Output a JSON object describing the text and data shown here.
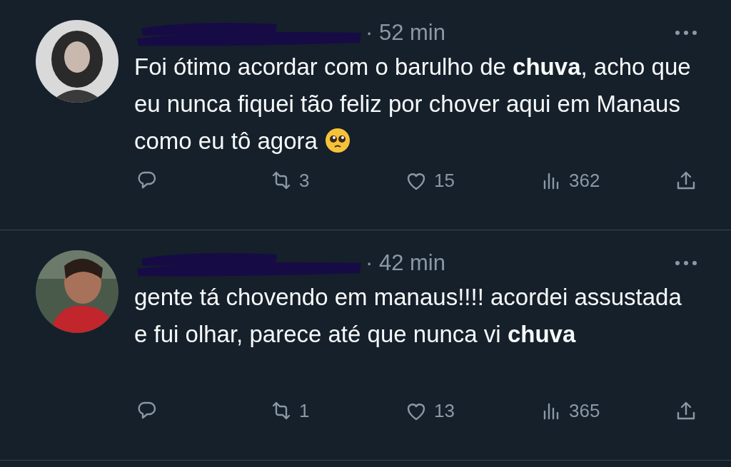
{
  "tweets": [
    {
      "time": "· 52 min",
      "text": "Foi ótimo acordar com o barulho de **chuva**, acho que eu nunca fiquei tão feliz por chover aqui em Manaus como eu tô agora",
      "emoji": true,
      "retweets": "3",
      "likes": "15",
      "views": "362"
    },
    {
      "time": "· 42 min",
      "text": "gente tá chovendo em manaus!!!! acordei assustada e fui olhar, parece até que nunca vi **chuva**",
      "emoji": false,
      "retweets": "1",
      "likes": "13",
      "views": "365"
    }
  ]
}
